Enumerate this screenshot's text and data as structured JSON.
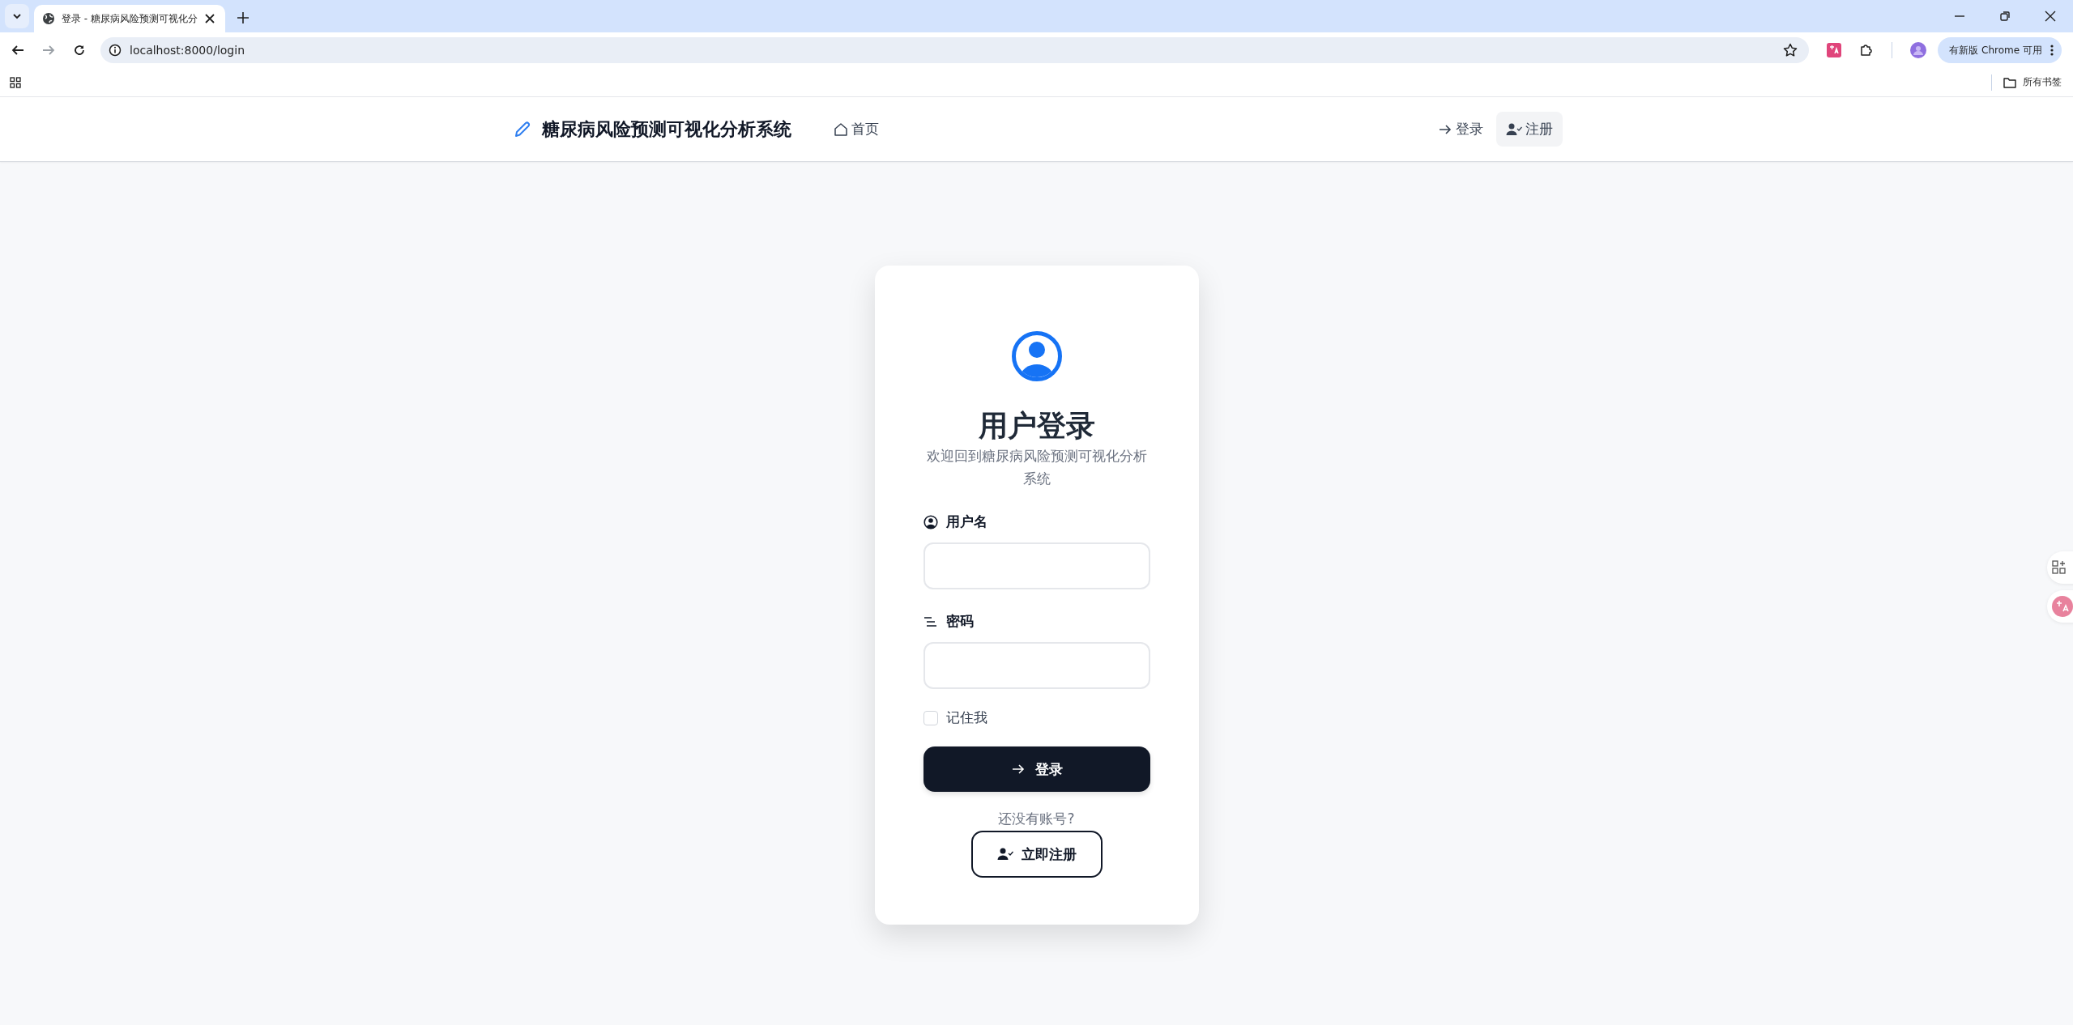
{
  "browser": {
    "tab_title": "登录 - 糖尿病风险预测可视化分",
    "address": "localhost:8000/login",
    "update_button": "有新版 Chrome 可用",
    "bookmarks_folder": "所有书签"
  },
  "nav": {
    "brand": "糖尿病风险预测可视化分析系统",
    "links": [
      {
        "label": "首页",
        "kind": "home",
        "highlighted": false
      },
      {
        "label": "登录",
        "kind": "login",
        "highlighted": false
      },
      {
        "label": "注册",
        "kind": "register",
        "highlighted": true
      }
    ]
  },
  "card": {
    "title": "用户登录",
    "subtitle": "欢迎回到糖尿病风险预测可视化分析系统",
    "fields": [
      {
        "label": "用户名",
        "kind": "user"
      },
      {
        "label": "密码",
        "kind": "password"
      }
    ],
    "remember": {
      "label": "记住我",
      "checked": false
    },
    "submit": "登录",
    "prompt": "还没有账号?",
    "register_button": "立即注册"
  }
}
